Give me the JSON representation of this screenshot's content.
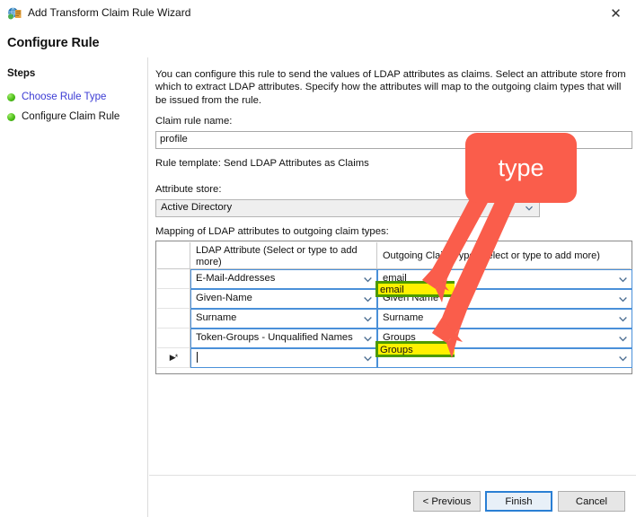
{
  "window": {
    "title": "Add Transform Claim Rule Wizard",
    "icon": "adfs-globe-icon",
    "close_icon": "close-icon"
  },
  "page": {
    "heading": "Configure Rule"
  },
  "sidebar": {
    "title": "Steps",
    "items": [
      {
        "label": "Choose Rule Type",
        "state": "completed-link"
      },
      {
        "label": "Configure Claim Rule",
        "state": "current"
      }
    ]
  },
  "main": {
    "intro": "You can configure this rule to send the values of LDAP attributes as claims. Select an attribute store from which to extract LDAP attributes. Specify how the attributes will map to the outgoing claim types that will be issued from the rule.",
    "claim_rule_name_label": "Claim rule name:",
    "claim_rule_name_value": "profile",
    "claim_rule_name_placeholder": "",
    "rule_template_label": "Rule template: Send LDAP Attributes as Claims",
    "attribute_store_label": "Attribute store:",
    "attribute_store_value": "Active Directory",
    "mapping_label": "Mapping of LDAP attributes to outgoing claim types:"
  },
  "grid": {
    "headers": [
      "",
      "LDAP Attribute (Select or type to add more)",
      "Outgoing Claim Type (Select or type to add more)"
    ],
    "rows": [
      {
        "selector": "",
        "ldap_attribute": "E-Mail-Addresses",
        "outgoing_claim_type": "email",
        "highlighted": true
      },
      {
        "selector": "",
        "ldap_attribute": "Given-Name",
        "outgoing_claim_type": "Given Name",
        "highlighted": false
      },
      {
        "selector": "",
        "ldap_attribute": "Surname",
        "outgoing_claim_type": "Surname",
        "highlighted": false
      },
      {
        "selector": "",
        "ldap_attribute": "Token-Groups - Unqualified Names",
        "outgoing_claim_type": "Groups",
        "highlighted": true
      },
      {
        "selector": "▶*",
        "ldap_attribute": "",
        "outgoing_claim_type": "",
        "highlighted": false
      }
    ]
  },
  "footer": {
    "previous_label": "< Previous",
    "finish_label": "Finish",
    "cancel_label": "Cancel"
  },
  "annotation": {
    "callout_text": "type",
    "callout_color": "#fa5d4b",
    "highlight_color": "#fff000",
    "highlight_border_color": "#4c9a00"
  }
}
